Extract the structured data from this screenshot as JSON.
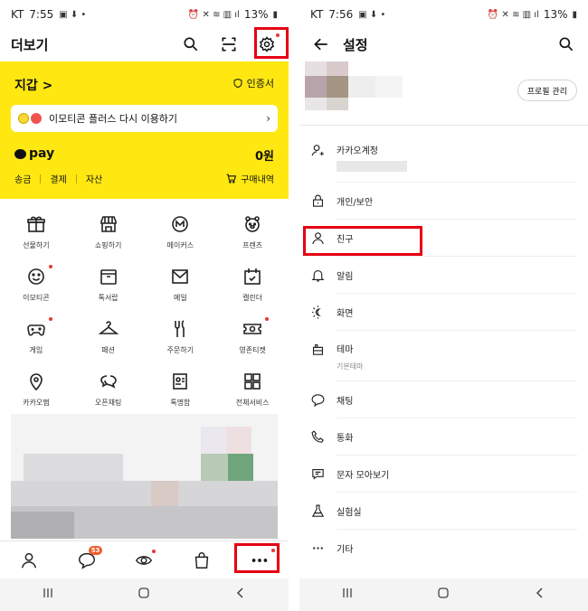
{
  "left": {
    "status": {
      "carrier": "KT",
      "time": "7:55",
      "battery": "13%"
    },
    "header": {
      "title": "더보기"
    },
    "wallet": {
      "title": "지갑 >",
      "cert_label": "인증서",
      "banner_text": "이모티콘 플러스 다시 이용하기",
      "pay_logo": "pay",
      "pay_amount": "0원",
      "links": [
        "송금",
        "결제",
        "자산"
      ],
      "purchase_label": "구매내역"
    },
    "grid": [
      {
        "label": "선물하기",
        "icon": "gift-icon",
        "dot": false
      },
      {
        "label": "쇼핑하기",
        "icon": "store-icon",
        "dot": false
      },
      {
        "label": "메이커스",
        "icon": "makers-icon",
        "dot": false
      },
      {
        "label": "프렌즈",
        "icon": "friends-character-icon",
        "dot": false
      },
      {
        "label": "이모티콘",
        "icon": "smile-icon",
        "dot": true
      },
      {
        "label": "톡서랍",
        "icon": "drawer-icon",
        "dot": false
      },
      {
        "label": "메일",
        "icon": "mail-icon",
        "dot": false
      },
      {
        "label": "캘린더",
        "icon": "calendar-icon",
        "dot": false
      },
      {
        "label": "게임",
        "icon": "gamepad-icon",
        "dot": true
      },
      {
        "label": "패션",
        "icon": "hanger-icon",
        "dot": false
      },
      {
        "label": "주문하기",
        "icon": "cutlery-icon",
        "dot": false
      },
      {
        "label": "영존티켓",
        "icon": "ticket-icon",
        "dot": true
      },
      {
        "label": "카카오맵",
        "icon": "map-pin-icon",
        "dot": false
      },
      {
        "label": "오픈채팅",
        "icon": "chat-bubbles-icon",
        "dot": false
      },
      {
        "label": "톡명함",
        "icon": "card-icon",
        "dot": false
      },
      {
        "label": "전체서비스",
        "icon": "apps-grid-icon",
        "dot": false
      }
    ],
    "bottom_nav": {
      "chat_badge": "53"
    }
  },
  "right": {
    "status": {
      "carrier": "KT",
      "time": "7:56",
      "battery": "13%"
    },
    "header": {
      "title": "설정"
    },
    "profile_button": "프로필 관리",
    "settings": [
      {
        "label": "카카오계정",
        "icon": "account-icon",
        "sub": ""
      },
      {
        "label": "개인/보안",
        "icon": "lock-icon",
        "sub": ""
      },
      {
        "label": "친구",
        "icon": "person-icon",
        "sub": ""
      },
      {
        "label": "알림",
        "icon": "bell-icon",
        "sub": ""
      },
      {
        "label": "화면",
        "icon": "brightness-icon",
        "sub": ""
      },
      {
        "label": "테마",
        "icon": "theme-icon",
        "sub": "기본테마"
      },
      {
        "label": "채팅",
        "icon": "chat-icon",
        "sub": ""
      },
      {
        "label": "통화",
        "icon": "phone-icon",
        "sub": ""
      },
      {
        "label": "문자 모아보기",
        "icon": "message-collect-icon",
        "sub": ""
      },
      {
        "label": "실험실",
        "icon": "flask-icon",
        "sub": ""
      },
      {
        "label": "기타",
        "icon": "more-icon",
        "sub": ""
      }
    ]
  },
  "colors": {
    "kakao_yellow": "#ffe812",
    "highlight_red": "#e60012",
    "badge_orange": "#f15a2b"
  }
}
